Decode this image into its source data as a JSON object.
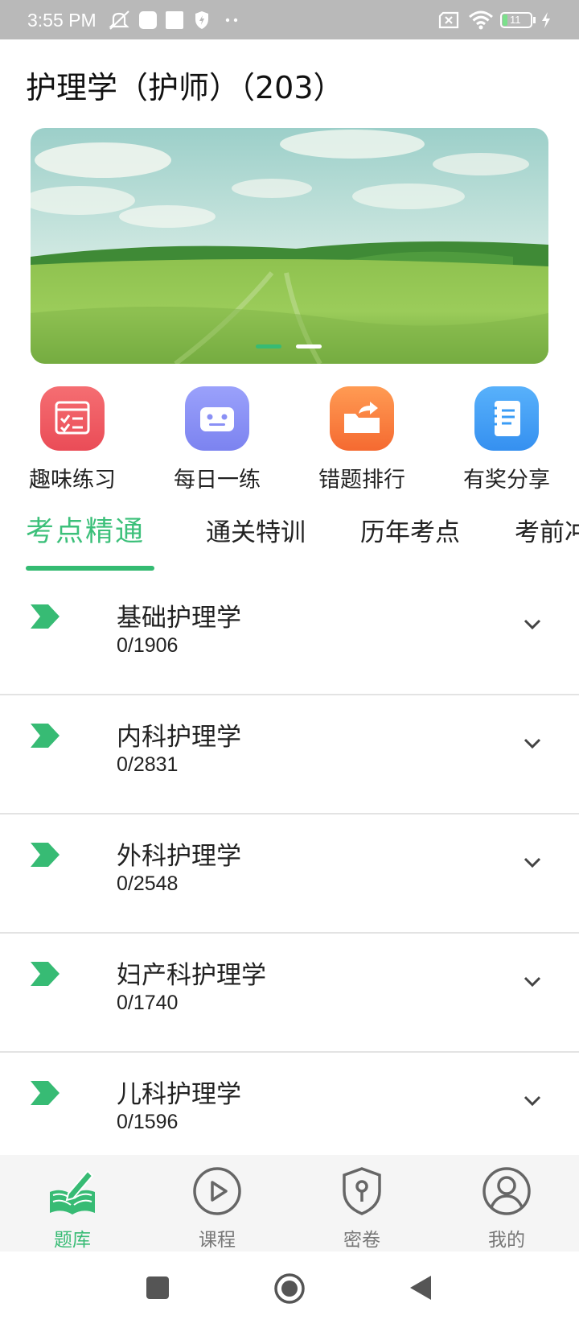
{
  "status_bar": {
    "time": "3:55 PM",
    "battery": "11"
  },
  "header": {
    "title": "护理学（护师）（203）"
  },
  "banner": {
    "slide_count": 2,
    "active_slide": 1
  },
  "quick_actions": [
    {
      "label": "趣味练习",
      "icon": "checklist-icon",
      "color": "#f0575f"
    },
    {
      "label": "每日一练",
      "icon": "robot-icon",
      "color": "#7f86f3"
    },
    {
      "label": "错题排行",
      "icon": "folder-share-icon",
      "color": "#fb7a3c"
    },
    {
      "label": "有奖分享",
      "icon": "notebook-icon",
      "color": "#3a9cf6"
    }
  ],
  "tabs": [
    {
      "label": "考点精通",
      "active": true
    },
    {
      "label": "通关特训",
      "active": false
    },
    {
      "label": "历年考点",
      "active": false
    },
    {
      "label": "考前冲",
      "active": false
    }
  ],
  "subjects": [
    {
      "name": "基础护理学",
      "progress": "0/1906"
    },
    {
      "name": "内科护理学",
      "progress": "0/2831"
    },
    {
      "name": "外科护理学",
      "progress": "0/2548"
    },
    {
      "name": "妇产科护理学",
      "progress": "0/1740"
    },
    {
      "name": "儿科护理学",
      "progress": "0/1596"
    }
  ],
  "bottom_nav": [
    {
      "label": "题库",
      "icon": "book-pen-icon",
      "active": true
    },
    {
      "label": "课程",
      "icon": "play-circle-icon",
      "active": false
    },
    {
      "label": "密卷",
      "icon": "shield-lock-icon",
      "active": false
    },
    {
      "label": "我的",
      "icon": "user-circle-icon",
      "active": false
    }
  ],
  "colors": {
    "accent": "#37bb74",
    "divider": "#e3e3e3",
    "status_bar": "#b9b9b9"
  }
}
